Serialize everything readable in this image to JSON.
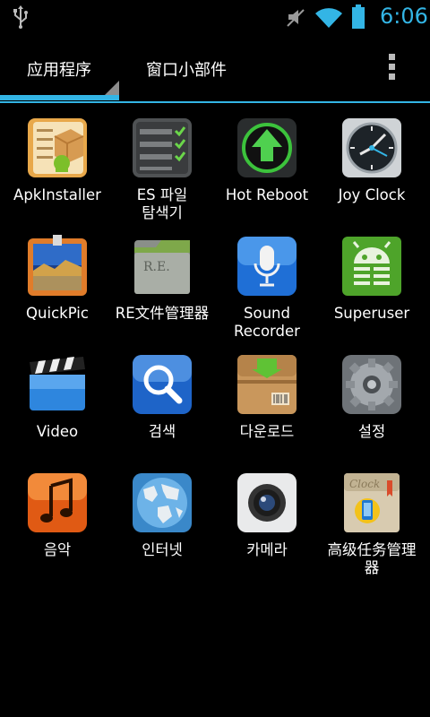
{
  "status_bar": {
    "time": "6:06",
    "icons": [
      "usb-icon",
      "mute-icon",
      "wifi-icon",
      "battery-icon"
    ],
    "accent_color": "#33b5e5"
  },
  "tabs": [
    {
      "label": "应用程序",
      "selected": true
    },
    {
      "label": "窗口小部件",
      "selected": false
    }
  ],
  "apps": [
    {
      "label": "ApkInstaller",
      "icon": "apk-installer-icon"
    },
    {
      "label": "ES 파일\n탐색기",
      "icon": "es-file-explorer-icon"
    },
    {
      "label": "Hot Reboot",
      "icon": "hot-reboot-icon"
    },
    {
      "label": "Joy Clock",
      "icon": "joy-clock-icon"
    },
    {
      "label": "QuickPic",
      "icon": "quickpic-icon"
    },
    {
      "label": "RE文件管理器",
      "icon": "re-file-manager-icon"
    },
    {
      "label": "Sound\nRecorder",
      "icon": "sound-recorder-icon"
    },
    {
      "label": "Superuser",
      "icon": "superuser-icon"
    },
    {
      "label": "Video",
      "icon": "video-icon"
    },
    {
      "label": "검색",
      "icon": "search-icon"
    },
    {
      "label": "다운로드",
      "icon": "downloads-icon"
    },
    {
      "label": "설정",
      "icon": "settings-icon"
    },
    {
      "label": "음악",
      "icon": "music-icon"
    },
    {
      "label": "인터넷",
      "icon": "internet-icon"
    },
    {
      "label": "카메라",
      "icon": "camera-icon"
    },
    {
      "label": "高级任务管理\n器",
      "icon": "task-manager-icon"
    }
  ]
}
